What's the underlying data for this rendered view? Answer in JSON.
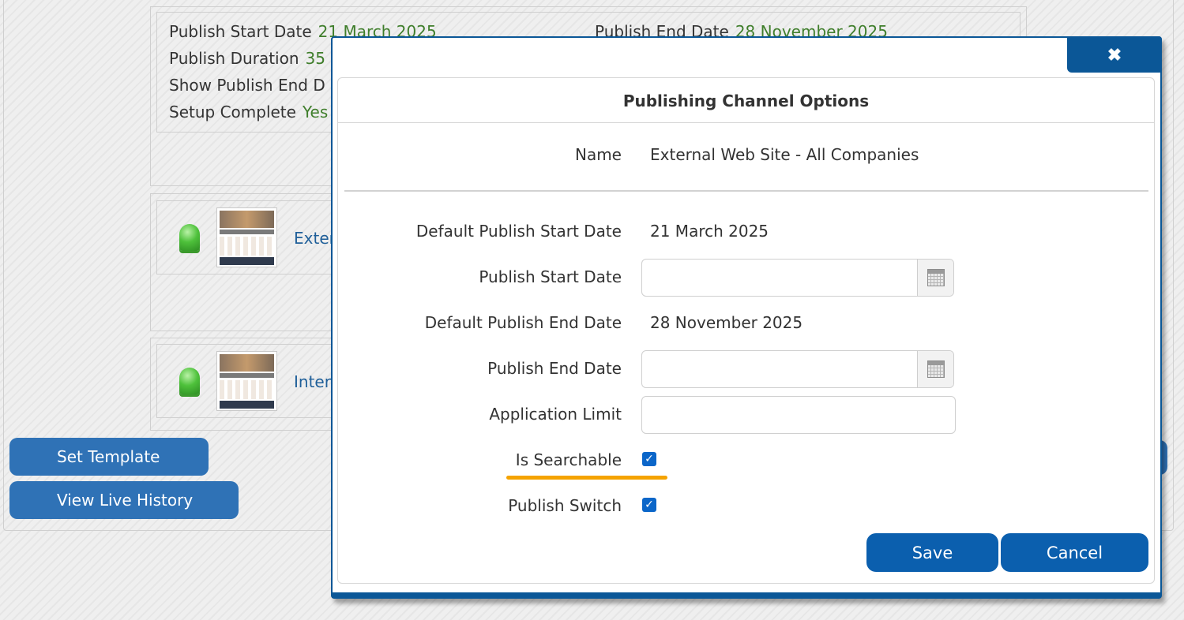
{
  "background": {
    "publish_start_label": "Publish Start Date",
    "publish_start_value": "21 March 2025",
    "publish_end_label": "Publish End Date",
    "publish_end_value": "28 November 2025",
    "duration_label": "Publish Duration",
    "duration_value": "35",
    "show_end_label": "Show Publish End D",
    "setup_label": "Setup Complete",
    "setup_value": "Yes",
    "channel_1_link": "Exter",
    "channel_2_link": "Inter",
    "set_template_label": "Set Template",
    "view_history_label": "View Live History"
  },
  "modal": {
    "close_glyph": "✖",
    "title": "Publishing Channel Options",
    "name_label": "Name",
    "name_value": "External Web Site - All Companies",
    "default_start_label": "Default Publish Start Date",
    "default_start_value": "21 March 2025",
    "start_label": "Publish Start Date",
    "start_value": "",
    "default_end_label": "Default Publish End Date",
    "default_end_value": "28 November 2025",
    "end_label": "Publish End Date",
    "end_value": "",
    "app_limit_label": "Application Limit",
    "app_limit_value": "",
    "searchable_label": "Is Searchable",
    "searchable_checked": true,
    "publish_switch_label": "Publish Switch",
    "publish_switch_checked": true,
    "save_label": "Save",
    "cancel_label": "Cancel"
  },
  "colors": {
    "primary": "#0b5fae",
    "modal_border": "#0b5797",
    "green_value": "#3f7e2b",
    "highlight": "#f5a300"
  }
}
